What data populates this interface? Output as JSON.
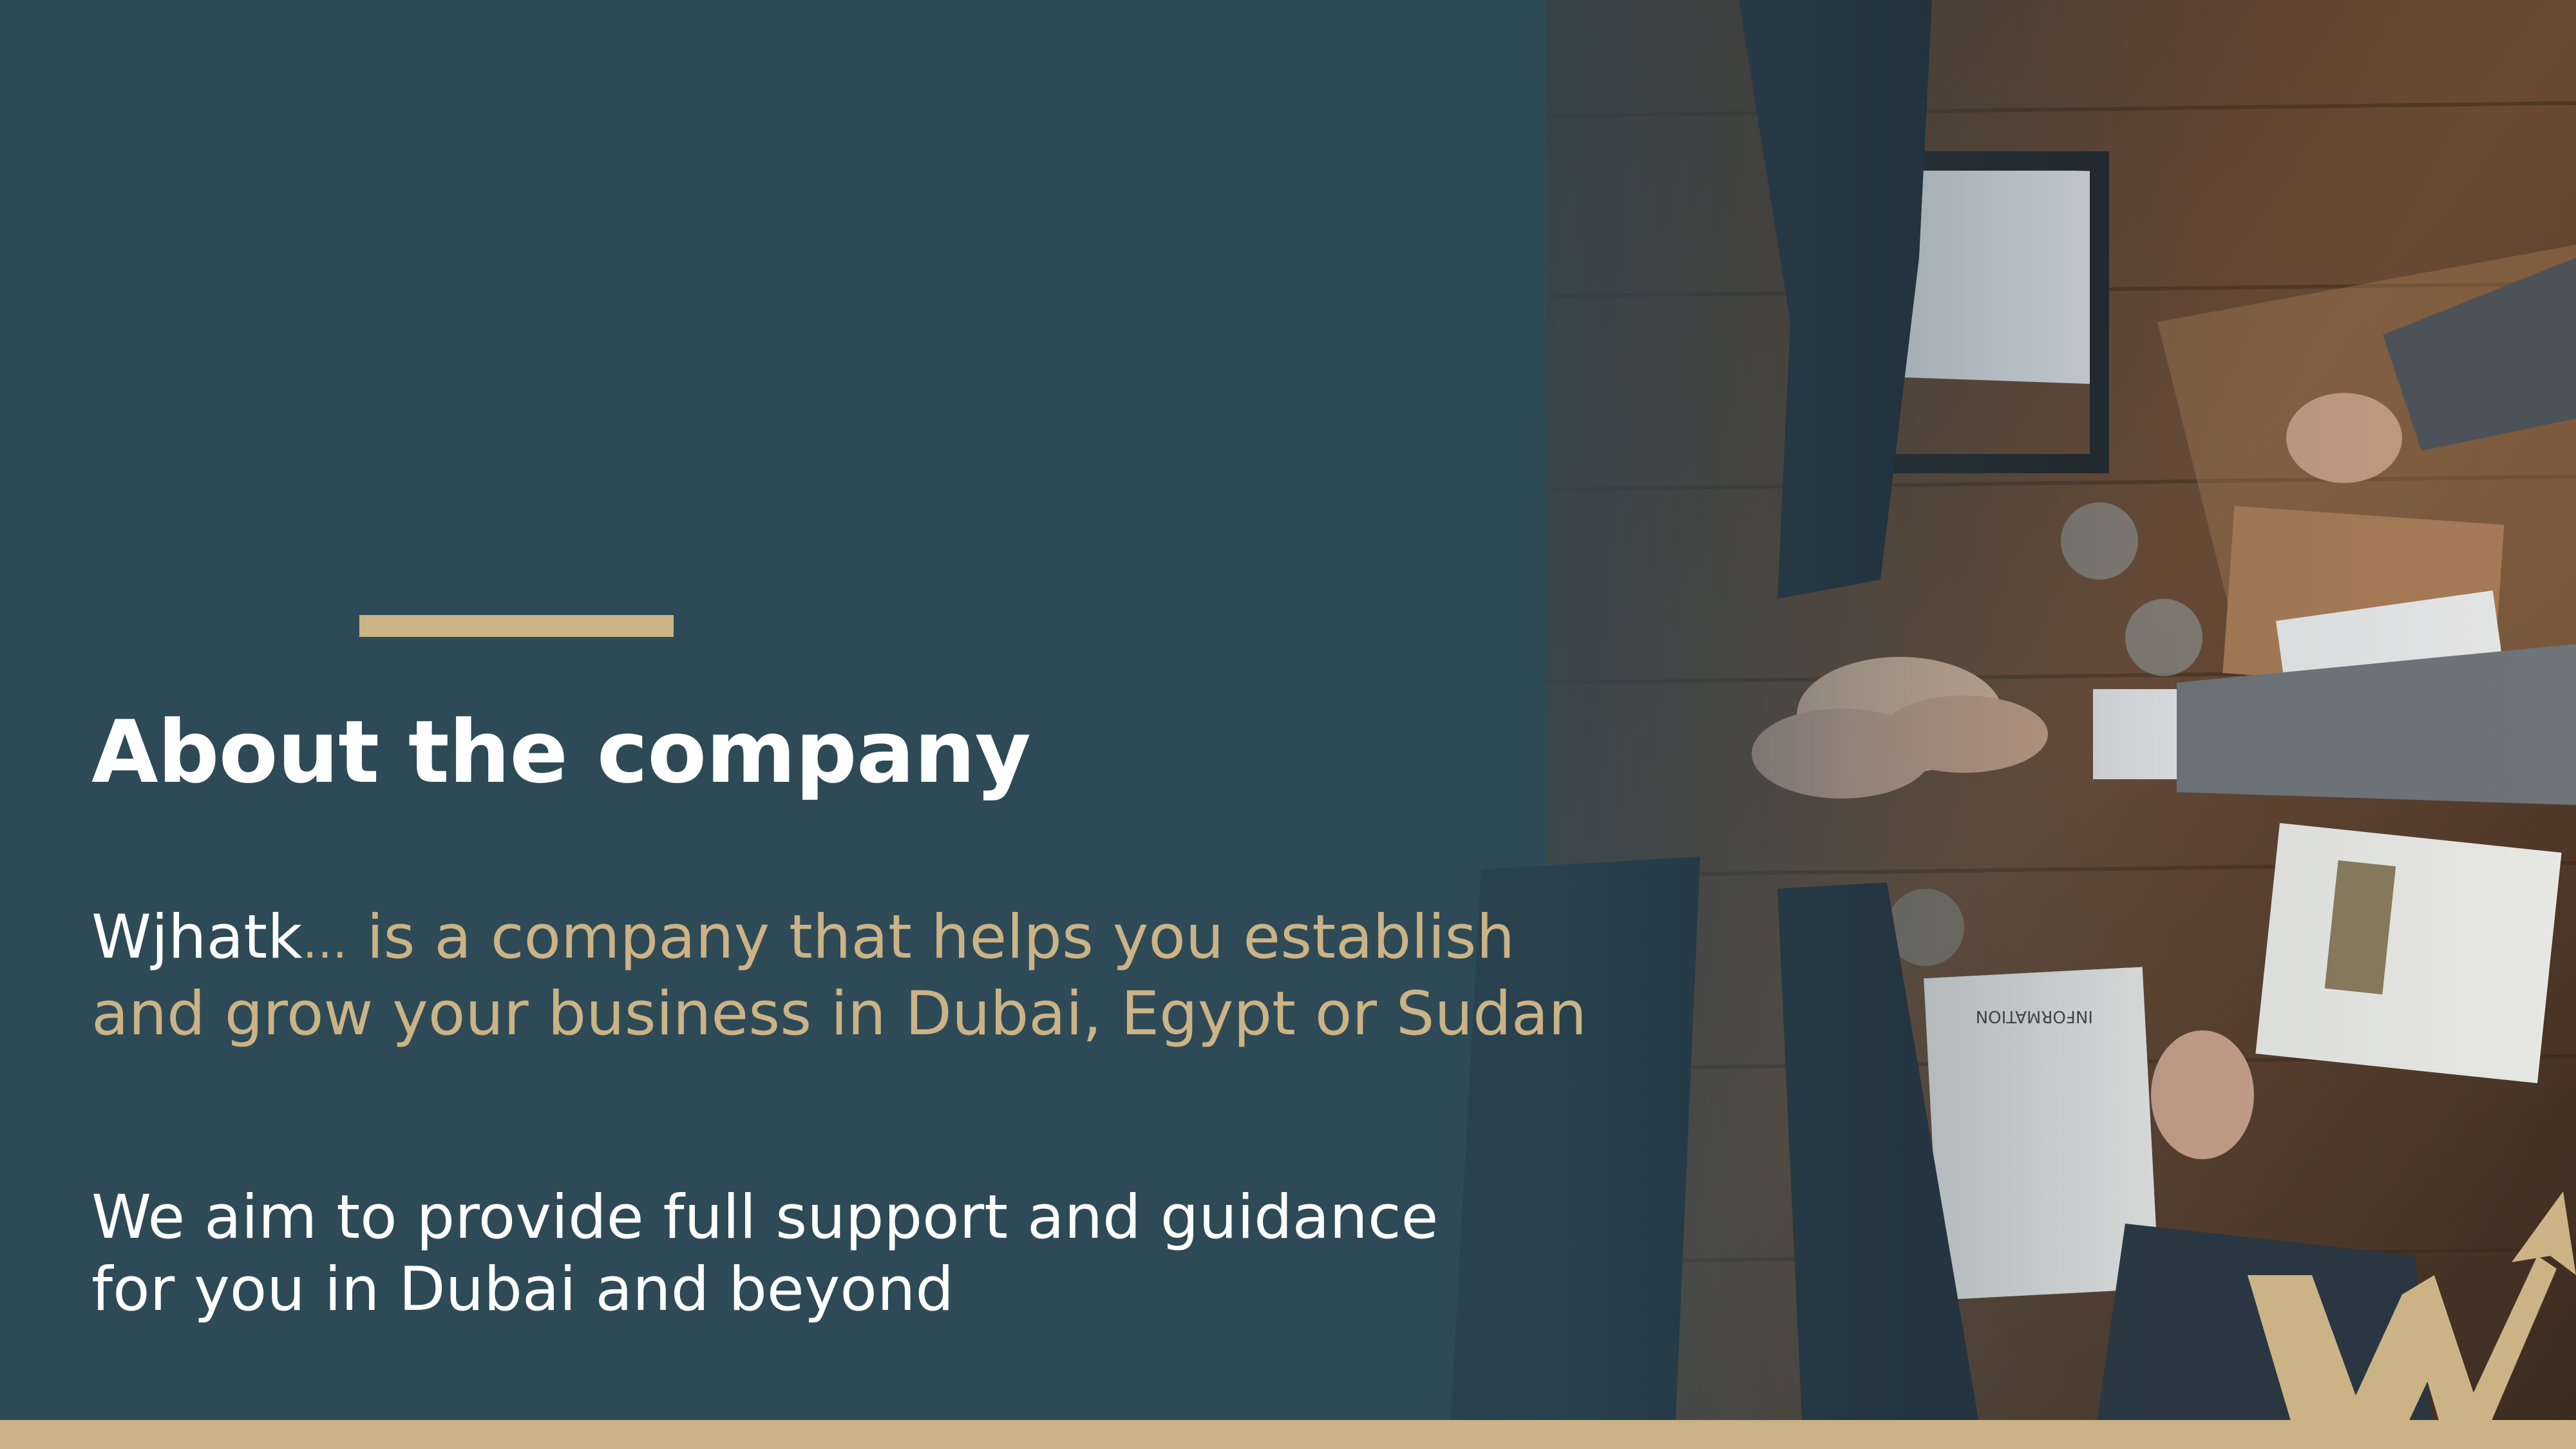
{
  "slide": {
    "title": "About the company",
    "paragraph1": {
      "brand": "Wjhatk",
      "ellipsis": "…",
      "line1_rest": " is a company that helps you establish",
      "line2": "and grow your business in Dubai, Egypt or Sudan"
    },
    "paragraph2": {
      "line1": "We aim to provide full support and guidance",
      "line2": "for you in Dubai and beyond"
    },
    "photo_text": "INFORMATION"
  },
  "colors": {
    "background": "#2e4a57",
    "accent_gold": "#cbb386",
    "text_white": "#ffffff"
  },
  "icons": {
    "logo": "wjhatk-w-arrow-logo"
  }
}
